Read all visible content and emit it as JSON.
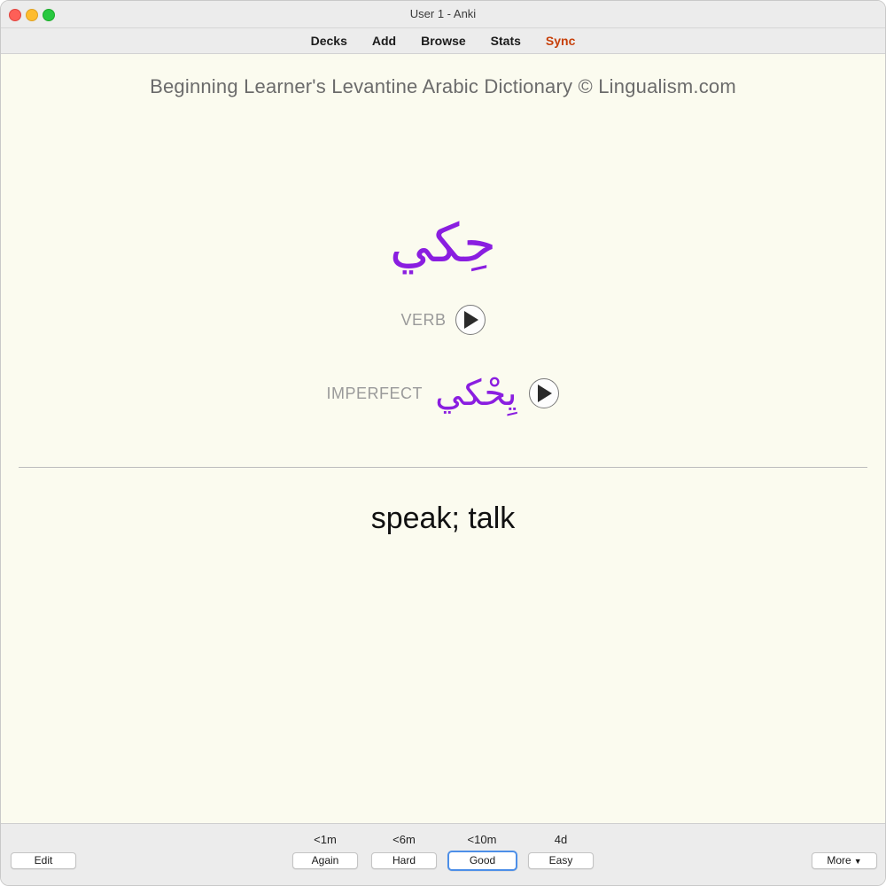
{
  "window": {
    "title": "User 1 - Anki"
  },
  "toolbar": {
    "decks": "Decks",
    "add": "Add",
    "browse": "Browse",
    "stats": "Stats",
    "sync": "Sync",
    "sync_color": "#c7400a"
  },
  "card": {
    "dictionary_title": "Beginning Learner's Levantine Arabic Dictionary © Lingualism.com",
    "word": "حِكي",
    "part_of_speech": "VERB",
    "imperfect_label": "IMPERFECT",
    "imperfect_word": "يِحْكي",
    "answer": "speak; talk",
    "arabic_color": "#8a1ee0",
    "play_icon": "play-icon"
  },
  "bottom": {
    "edit": "Edit",
    "more": "More",
    "answers": [
      {
        "interval": "<1m",
        "label": "Again"
      },
      {
        "interval": "<6m",
        "label": "Hard"
      },
      {
        "interval": "<10m",
        "label": "Good"
      },
      {
        "interval": "4d",
        "label": "Easy"
      }
    ]
  }
}
